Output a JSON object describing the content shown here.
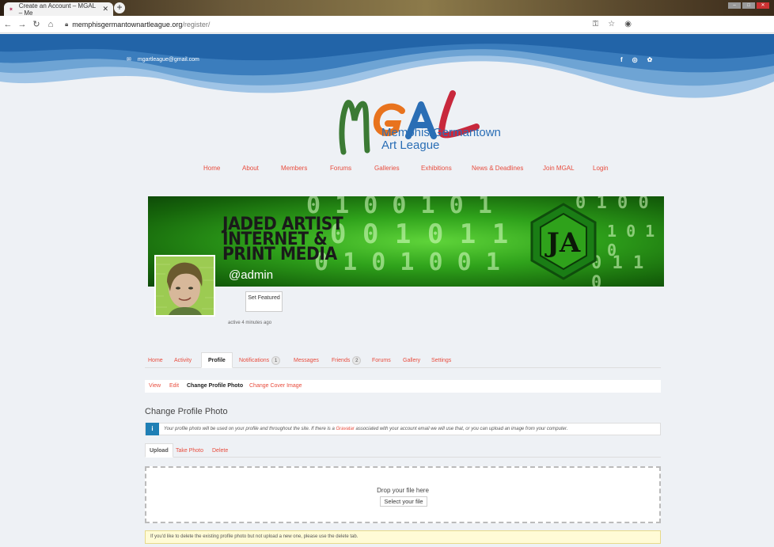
{
  "browser": {
    "tab_title": "Create an Account – MGAL – Me",
    "tab_favicon": "pinwheel-icon",
    "new_tab": "+",
    "url_host": "memphisgermantownartleague.org",
    "url_path": "/register/"
  },
  "header": {
    "email": "mgartleague@gmail.com",
    "social": [
      "f",
      "◎",
      "✿"
    ],
    "wave_colors": [
      "#2264a8",
      "#3b7dbd",
      "#6ea4d4",
      "#9fc4e6"
    ]
  },
  "logo": {
    "letters": [
      "M",
      "G",
      "A",
      "L"
    ],
    "line1": "Memphis/Germantown",
    "line2": "Art League",
    "colors": {
      "M": "#3b7a34",
      "G": "#e8731e",
      "A": "#2a6eb5",
      "L": "#c8283c"
    }
  },
  "nav": [
    "Home",
    "About",
    "Members",
    "Forums",
    "Galleries",
    "Exhibitions",
    "News & Deadlines",
    "Join MGAL",
    "Login"
  ],
  "profile": {
    "cover_title": [
      "JADED ARTIST",
      "INTERNET &",
      "PRINT MEDIA"
    ],
    "cover_logo_text": "JA",
    "handle": "@admin",
    "featured_button": "Set Featured",
    "active": "active 4 minutes ago"
  },
  "profile_tabs": [
    {
      "label": "Home"
    },
    {
      "label": "Activity"
    },
    {
      "label": "Profile",
      "selected": true
    },
    {
      "label": "Notifications",
      "count": "1"
    },
    {
      "label": "Messages"
    },
    {
      "label": "Friends",
      "count": "2"
    },
    {
      "label": "Forums"
    },
    {
      "label": "Gallery"
    },
    {
      "label": "Settings"
    }
  ],
  "subnav": [
    "View",
    "Edit",
    "Change Profile Photo",
    "Change Cover Image"
  ],
  "section": {
    "title": "Change Profile Photo",
    "info_before": "Your profile photo will be used on your profile and throughout the site. If there is a ",
    "info_link": "Gravatar",
    "info_after": " associated with your account email we will use that, or you can upload an image from your computer."
  },
  "upload_tabs": [
    "Upload",
    "Take Photo",
    "Delete"
  ],
  "dropzone": {
    "text": "Drop your file here",
    "button": "Select your file"
  },
  "warning": "If you'd like to delete the existing profile photo but not upload a new one, please use the delete tab.",
  "colors": {
    "accent": "#e84c3d",
    "info": "#1f7fb5"
  }
}
